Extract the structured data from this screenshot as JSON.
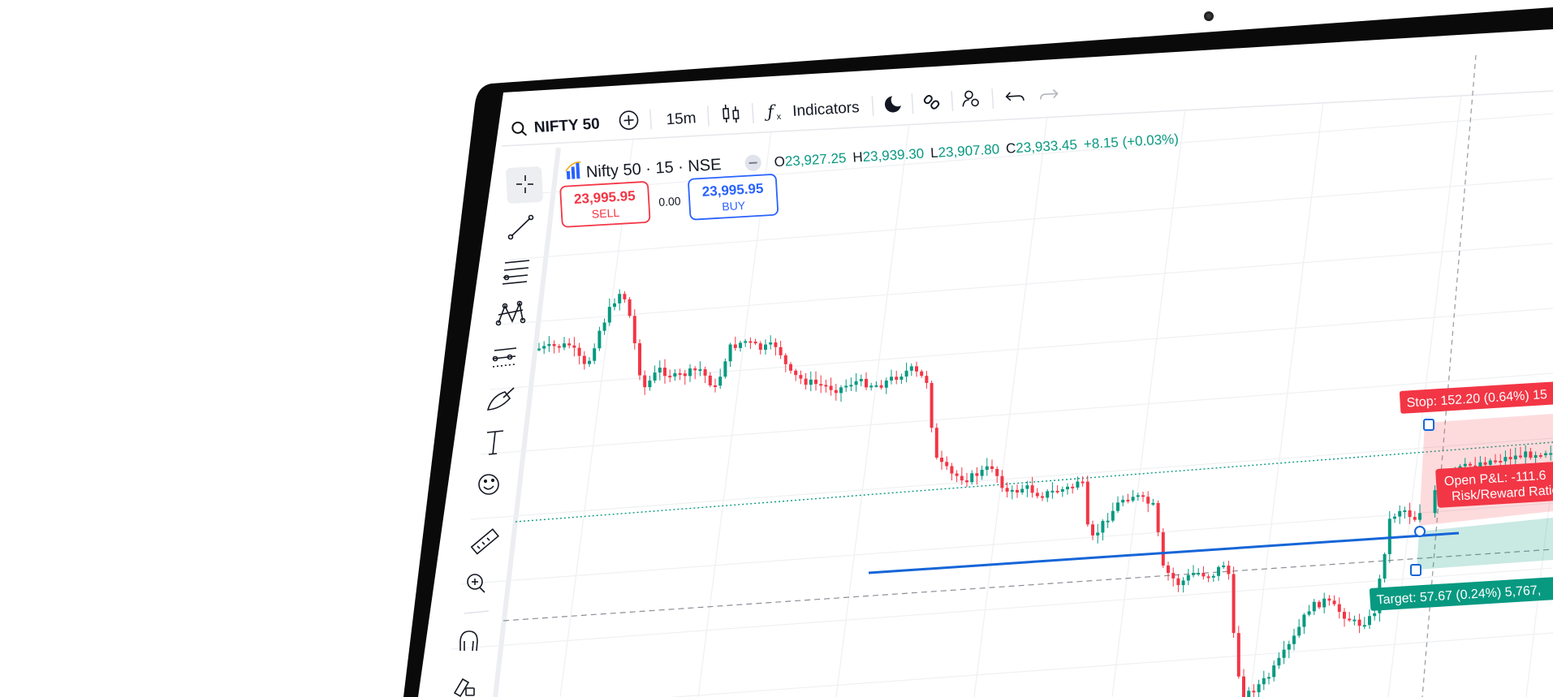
{
  "toolbar": {
    "symbol": "NIFTY 50",
    "interval": "15m",
    "indicators_label": "Indicators"
  },
  "chart_header": {
    "title": "Nifty 50 · 15 · NSE",
    "open_label": "O",
    "open": "23,927.25",
    "high_label": "H",
    "high": "23,939.30",
    "low_label": "L",
    "low": "23,907.80",
    "close_label": "C",
    "close": "23,933.45",
    "change": "+8.15 (+0.03%)"
  },
  "trade": {
    "sell_price": "23,995.95",
    "sell_label": "SELL",
    "spread": "0.00",
    "buy_price": "23,995.95",
    "buy_label": "BUY"
  },
  "position": {
    "stop_label": "Stop: 152.20 (0.64%) 15",
    "open_pnl_label": "Open P&L: -111.6",
    "risk_reward_label": "Risk/Reward Ratio",
    "target_label": "Target: 57.67 (0.24%) 5,767,"
  },
  "colors": {
    "up": "#089981",
    "down": "#f23645",
    "trendline": "#1565d8",
    "accent_blue": "#2962ff"
  },
  "tools": [
    "crosshair-icon",
    "trendline-icon",
    "fib-icon",
    "pattern-icon",
    "projection-icon",
    "brush-icon",
    "text-icon",
    "emoji-icon",
    "ruler-icon",
    "zoom-in-icon",
    "magnet-icon",
    "lock-draw-icon"
  ]
}
